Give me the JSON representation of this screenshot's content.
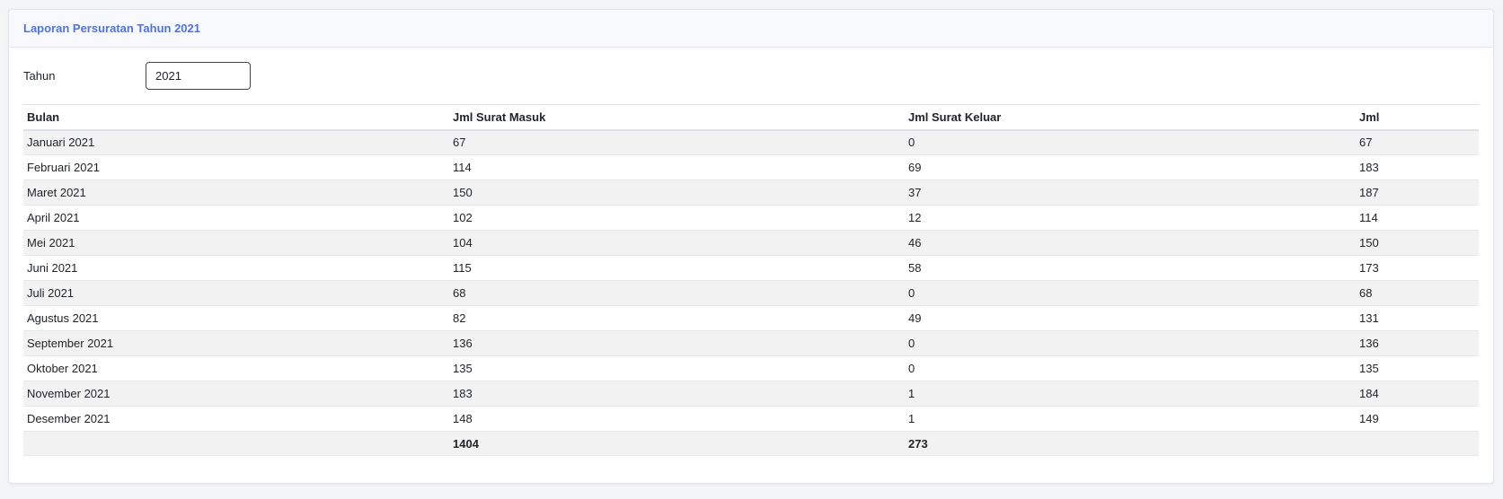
{
  "card": {
    "title": "Laporan Persuratan Tahun 2021"
  },
  "filter": {
    "label": "Tahun",
    "year_value": "2021"
  },
  "table": {
    "columns": [
      "Bulan",
      "Jml Surat Masuk",
      "Jml Surat Keluar",
      "Jml"
    ],
    "rows": [
      [
        "Januari 2021",
        "67",
        "0",
        "67"
      ],
      [
        "Februari 2021",
        "114",
        "69",
        "183"
      ],
      [
        "Maret 2021",
        "150",
        "37",
        "187"
      ],
      [
        "April 2021",
        "102",
        "12",
        "114"
      ],
      [
        "Mei 2021",
        "104",
        "46",
        "150"
      ],
      [
        "Juni 2021",
        "115",
        "58",
        "173"
      ],
      [
        "Juli 2021",
        "68",
        "0",
        "68"
      ],
      [
        "Agustus 2021",
        "82",
        "49",
        "131"
      ],
      [
        "September 2021",
        "136",
        "0",
        "136"
      ],
      [
        "Oktober 2021",
        "135",
        "0",
        "135"
      ],
      [
        "November 2021",
        "183",
        "1",
        "184"
      ],
      [
        "Desember 2021",
        "148",
        "1",
        "149"
      ]
    ],
    "totals": [
      "",
      "1404",
      "273",
      ""
    ]
  },
  "colors": {
    "title_accent": "#4e73df",
    "header_bg": "#f8f9fc",
    "stripe": "#f2f2f2"
  }
}
